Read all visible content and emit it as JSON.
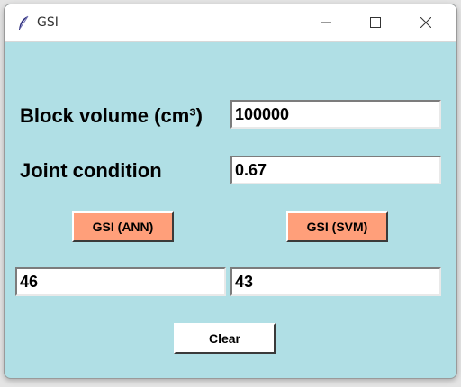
{
  "window": {
    "title": "GSI",
    "icon": "feather-icon",
    "controls": [
      "minimize-icon",
      "maximize-icon",
      "close-icon"
    ]
  },
  "form": {
    "block_volume_label": "Block volume (cm³)",
    "block_volume_value": "100000",
    "joint_condition_label": "Joint condition",
    "joint_condition_value": "0.67"
  },
  "buttons": {
    "gsi_ann": "GSI (ANN)",
    "gsi_svm": "GSI (SVM)",
    "clear": "Clear"
  },
  "results": {
    "ann_value": "46",
    "svm_value": "43"
  },
  "colors": {
    "background": "#b0dfe5",
    "action_button": "#ff9f7a",
    "clear_button": "#ffffff"
  }
}
